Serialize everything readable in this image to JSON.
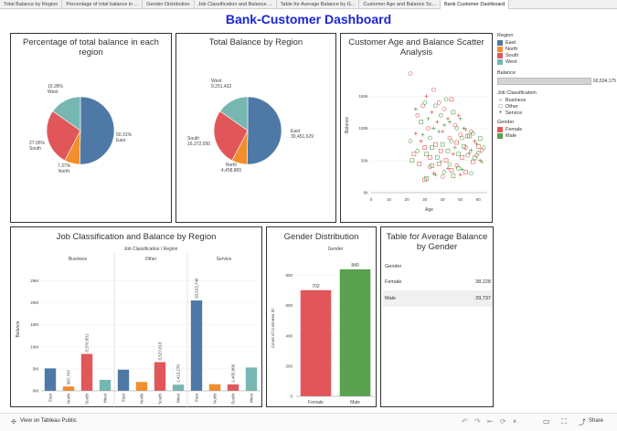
{
  "tabs": [
    {
      "label": "Total Balance by Region"
    },
    {
      "label": "Percentage of total balance in ..."
    },
    {
      "label": "Gender Distribution"
    },
    {
      "label": "Job Classification and Balance ..."
    },
    {
      "label": "Table for Average Balance by G..."
    },
    {
      "label": "Customer Age and Balance Sc..."
    },
    {
      "label": "Bank Customer Dashboard"
    }
  ],
  "dashboard_title": "Bank-Customer Dashboard",
  "colors": {
    "East": "#4e79a7",
    "North": "#f28e2b",
    "South": "#e15759",
    "West": "#76b7b2",
    "Female": "#e15759",
    "Male": "#59a14f",
    "title": "#1a24d6"
  },
  "panels": {
    "pct_title": "Percentage of total balance in each region",
    "total_title": "Total Balance by Region",
    "scatter_title": "Customer Age and Balance Scatter Analysis",
    "job_title": "Job Classification and Balance by Region",
    "gender_title": "Gender Distribution",
    "table_title": "Table for Average Balance by Gender"
  },
  "legend": {
    "region_title": "Region",
    "regions": [
      "East",
      "North",
      "South",
      "West"
    ],
    "balance_title": "Balance",
    "balance_value": "60,534,175",
    "job_title": "Job Classification",
    "jobs": [
      "Business",
      "Other",
      "Service"
    ],
    "gender_title": "Gender",
    "genders": [
      "Female",
      "Male"
    ]
  },
  "table": {
    "header": "Gender",
    "rows": [
      {
        "gender": "Female",
        "value": "38,228"
      },
      {
        "gender": "Male",
        "value": "39,737"
      }
    ]
  },
  "footer": {
    "view_label": "View on Tableau Public",
    "share_label": "Share"
  },
  "chart_data": [
    {
      "id": "pct",
      "type": "pie",
      "title": "Percentage of total balance in each region",
      "categories": [
        "East",
        "North",
        "South",
        "West"
      ],
      "values": [
        50.31,
        7.37,
        27.05,
        15.28
      ],
      "labels": [
        "50.31%\nEast",
        "7.37%\nNorth",
        "27.05%\nSouth",
        "15.28%\nWest"
      ]
    },
    {
      "id": "total",
      "type": "pie",
      "title": "Total Balance by Region",
      "categories": [
        "East",
        "North",
        "South",
        "West"
      ],
      "values": [
        30451629,
        4458865,
        16372050,
        9251432
      ],
      "labels": [
        "East\n30,451,629",
        "North\n4,458,865",
        "South\n16,372,050",
        "West\n9,251,432"
      ]
    },
    {
      "id": "scatter",
      "type": "scatter",
      "title": "Customer Age and Balance Scatter Analysis",
      "xlabel": "Age",
      "ylabel": "Balance",
      "xlim": [
        0,
        65
      ],
      "ylim": [
        0,
        210000
      ],
      "xticks": [
        0,
        10,
        20,
        30,
        40,
        50,
        60
      ],
      "yticks": [
        0,
        50000,
        100000,
        150000
      ],
      "ytick_labels": [
        "0K",
        "50K",
        "100K",
        "150K"
      ],
      "series": [
        {
          "name": "Female",
          "points": [
            [
              22,
              185000
            ],
            [
              24,
              60000
            ],
            [
              25,
              92000
            ],
            [
              26,
              120000
            ],
            [
              27,
              45000
            ],
            [
              28,
              80000
            ],
            [
              29,
              135000
            ],
            [
              30,
              70000
            ],
            [
              31,
              150000
            ],
            [
              32,
              100000
            ],
            [
              33,
              55000
            ],
            [
              34,
              125000
            ],
            [
              35,
              160000
            ],
            [
              36,
              75000
            ],
            [
              37,
              110000
            ],
            [
              38,
              140000
            ],
            [
              39,
              65000
            ],
            [
              40,
              95000
            ],
            [
              41,
              130000
            ],
            [
              42,
              50000
            ],
            [
              43,
              115000
            ],
            [
              44,
              85000
            ],
            [
              45,
              145000
            ],
            [
              46,
              60000
            ],
            [
              47,
              105000
            ],
            [
              48,
              78000
            ],
            [
              49,
              120000
            ],
            [
              50,
              90000
            ],
            [
              51,
              55000
            ],
            [
              52,
              100000
            ],
            [
              53,
              70000
            ],
            [
              54,
              88000
            ],
            [
              55,
              62000
            ],
            [
              56,
              95000
            ],
            [
              57,
              48000
            ],
            [
              58,
              80000
            ],
            [
              59,
              58000
            ],
            [
              60,
              72000
            ],
            [
              61,
              50000
            ],
            [
              62,
              66000
            ],
            [
              30,
              20000
            ],
            [
              35,
              30000
            ],
            [
              40,
              25000
            ],
            [
              45,
              35000
            ],
            [
              50,
              28000
            ],
            [
              33,
              40000
            ],
            [
              38,
              45000
            ],
            [
              43,
              38000
            ],
            [
              48,
              42000
            ],
            [
              53,
              32000
            ]
          ]
        },
        {
          "name": "Male",
          "points": [
            [
              22,
              80000
            ],
            [
              23,
              50000
            ],
            [
              25,
              130000
            ],
            [
              26,
              65000
            ],
            [
              28,
              110000
            ],
            [
              29,
              90000
            ],
            [
              30,
              140000
            ],
            [
              31,
              60000
            ],
            [
              32,
              115000
            ],
            [
              33,
              85000
            ],
            [
              34,
              70000
            ],
            [
              35,
              100000
            ],
            [
              36,
              135000
            ],
            [
              37,
              55000
            ],
            [
              38,
              95000
            ],
            [
              39,
              120000
            ],
            [
              40,
              75000
            ],
            [
              41,
              105000
            ],
            [
              42,
              145000
            ],
            [
              43,
              65000
            ],
            [
              44,
              110000
            ],
            [
              45,
              80000
            ],
            [
              46,
              125000
            ],
            [
              47,
              70000
            ],
            [
              48,
              100000
            ],
            [
              49,
              60000
            ],
            [
              50,
              115000
            ],
            [
              51,
              85000
            ],
            [
              52,
              72000
            ],
            [
              53,
              98000
            ],
            [
              54,
              58000
            ],
            [
              55,
              88000
            ],
            [
              56,
              66000
            ],
            [
              57,
              92000
            ],
            [
              58,
              54000
            ],
            [
              59,
              76000
            ],
            [
              60,
              62000
            ],
            [
              61,
              84000
            ],
            [
              62,
              48000
            ],
            [
              63,
              70000
            ],
            [
              31,
              22000
            ],
            [
              36,
              28000
            ],
            [
              41,
              32000
            ],
            [
              46,
              26000
            ],
            [
              51,
              36000
            ],
            [
              56,
              30000
            ],
            [
              34,
              42000
            ],
            [
              39,
              48000
            ],
            [
              44,
              44000
            ],
            [
              49,
              38000
            ]
          ]
        }
      ]
    },
    {
      "id": "job",
      "type": "bar",
      "title": "Job Classification and Balance by Region",
      "header": "Job Classification / Region",
      "ylabel": "Balance",
      "ylim": [
        0,
        28000000
      ],
      "yticks": [
        0,
        5000000,
        10000000,
        15000000,
        20000000,
        25000000
      ],
      "ytick_labels": [
        "0M",
        "5M",
        "10M",
        "15M",
        "20M",
        "25M"
      ],
      "groups": [
        {
          "name": "Business",
          "categories": [
            "East",
            "North",
            "South",
            "West"
          ],
          "values": [
            5100000,
            987707,
            8376831,
            2500000
          ],
          "labels": [
            "",
            "987,707",
            "8,376,831",
            ""
          ]
        },
        {
          "name": "Other",
          "categories": [
            "East",
            "North",
            "South",
            "West"
          ],
          "values": [
            4800000,
            2000000,
            6527018,
            1413270
          ],
          "labels": [
            "",
            "",
            "6,527,018",
            "1,413,270"
          ]
        },
        {
          "name": "Service",
          "categories": [
            "East",
            "North",
            "South",
            "West"
          ],
          "values": [
            20523746,
            1500000,
            1465806,
            5300000
          ],
          "labels": [
            "20,523,746",
            "",
            "1,465,806",
            ""
          ]
        }
      ]
    },
    {
      "id": "gender",
      "type": "bar",
      "title": "Gender Distribution",
      "header": "Gender",
      "ylabel": "Count of Customer ID",
      "ylim": [
        0,
        900
      ],
      "yticks": [
        0,
        200,
        400,
        600,
        800
      ],
      "categories": [
        "Female",
        "Male"
      ],
      "values": [
        702,
        840
      ]
    }
  ]
}
